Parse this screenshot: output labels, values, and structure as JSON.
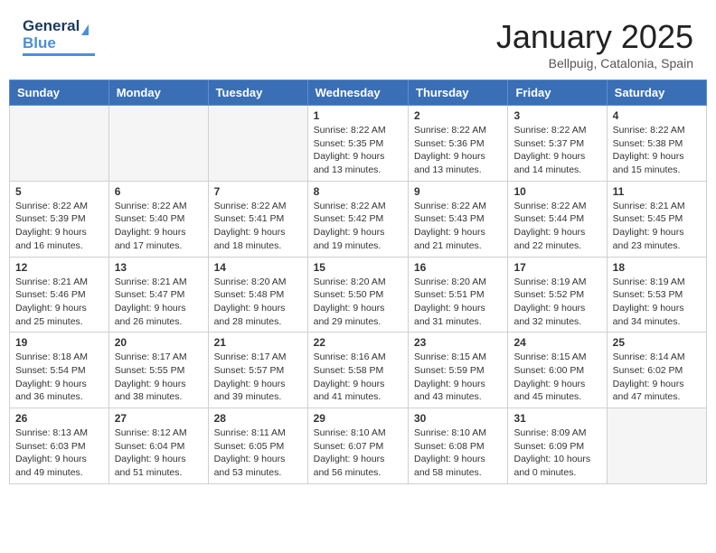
{
  "header": {
    "logo_general": "General",
    "logo_blue": "Blue",
    "month": "January 2025",
    "location": "Bellpuig, Catalonia, Spain"
  },
  "weekdays": [
    "Sunday",
    "Monday",
    "Tuesday",
    "Wednesday",
    "Thursday",
    "Friday",
    "Saturday"
  ],
  "weeks": [
    [
      {
        "day": "",
        "empty": true
      },
      {
        "day": "",
        "empty": true
      },
      {
        "day": "",
        "empty": true
      },
      {
        "day": "1",
        "sunrise": "8:22 AM",
        "sunset": "5:35 PM",
        "daylight": "9 hours and 13 minutes."
      },
      {
        "day": "2",
        "sunrise": "8:22 AM",
        "sunset": "5:36 PM",
        "daylight": "9 hours and 13 minutes."
      },
      {
        "day": "3",
        "sunrise": "8:22 AM",
        "sunset": "5:37 PM",
        "daylight": "9 hours and 14 minutes."
      },
      {
        "day": "4",
        "sunrise": "8:22 AM",
        "sunset": "5:38 PM",
        "daylight": "9 hours and 15 minutes."
      }
    ],
    [
      {
        "day": "5",
        "sunrise": "8:22 AM",
        "sunset": "5:39 PM",
        "daylight": "9 hours and 16 minutes."
      },
      {
        "day": "6",
        "sunrise": "8:22 AM",
        "sunset": "5:40 PM",
        "daylight": "9 hours and 17 minutes."
      },
      {
        "day": "7",
        "sunrise": "8:22 AM",
        "sunset": "5:41 PM",
        "daylight": "9 hours and 18 minutes."
      },
      {
        "day": "8",
        "sunrise": "8:22 AM",
        "sunset": "5:42 PM",
        "daylight": "9 hours and 19 minutes."
      },
      {
        "day": "9",
        "sunrise": "8:22 AM",
        "sunset": "5:43 PM",
        "daylight": "9 hours and 21 minutes."
      },
      {
        "day": "10",
        "sunrise": "8:22 AM",
        "sunset": "5:44 PM",
        "daylight": "9 hours and 22 minutes."
      },
      {
        "day": "11",
        "sunrise": "8:21 AM",
        "sunset": "5:45 PM",
        "daylight": "9 hours and 23 minutes."
      }
    ],
    [
      {
        "day": "12",
        "sunrise": "8:21 AM",
        "sunset": "5:46 PM",
        "daylight": "9 hours and 25 minutes."
      },
      {
        "day": "13",
        "sunrise": "8:21 AM",
        "sunset": "5:47 PM",
        "daylight": "9 hours and 26 minutes."
      },
      {
        "day": "14",
        "sunrise": "8:20 AM",
        "sunset": "5:48 PM",
        "daylight": "9 hours and 28 minutes."
      },
      {
        "day": "15",
        "sunrise": "8:20 AM",
        "sunset": "5:50 PM",
        "daylight": "9 hours and 29 minutes."
      },
      {
        "day": "16",
        "sunrise": "8:20 AM",
        "sunset": "5:51 PM",
        "daylight": "9 hours and 31 minutes."
      },
      {
        "day": "17",
        "sunrise": "8:19 AM",
        "sunset": "5:52 PM",
        "daylight": "9 hours and 32 minutes."
      },
      {
        "day": "18",
        "sunrise": "8:19 AM",
        "sunset": "5:53 PM",
        "daylight": "9 hours and 34 minutes."
      }
    ],
    [
      {
        "day": "19",
        "sunrise": "8:18 AM",
        "sunset": "5:54 PM",
        "daylight": "9 hours and 36 minutes."
      },
      {
        "day": "20",
        "sunrise": "8:17 AM",
        "sunset": "5:55 PM",
        "daylight": "9 hours and 38 minutes."
      },
      {
        "day": "21",
        "sunrise": "8:17 AM",
        "sunset": "5:57 PM",
        "daylight": "9 hours and 39 minutes."
      },
      {
        "day": "22",
        "sunrise": "8:16 AM",
        "sunset": "5:58 PM",
        "daylight": "9 hours and 41 minutes."
      },
      {
        "day": "23",
        "sunrise": "8:15 AM",
        "sunset": "5:59 PM",
        "daylight": "9 hours and 43 minutes."
      },
      {
        "day": "24",
        "sunrise": "8:15 AM",
        "sunset": "6:00 PM",
        "daylight": "9 hours and 45 minutes."
      },
      {
        "day": "25",
        "sunrise": "8:14 AM",
        "sunset": "6:02 PM",
        "daylight": "9 hours and 47 minutes."
      }
    ],
    [
      {
        "day": "26",
        "sunrise": "8:13 AM",
        "sunset": "6:03 PM",
        "daylight": "9 hours and 49 minutes."
      },
      {
        "day": "27",
        "sunrise": "8:12 AM",
        "sunset": "6:04 PM",
        "daylight": "9 hours and 51 minutes."
      },
      {
        "day": "28",
        "sunrise": "8:11 AM",
        "sunset": "6:05 PM",
        "daylight": "9 hours and 53 minutes."
      },
      {
        "day": "29",
        "sunrise": "8:10 AM",
        "sunset": "6:07 PM",
        "daylight": "9 hours and 56 minutes."
      },
      {
        "day": "30",
        "sunrise": "8:10 AM",
        "sunset": "6:08 PM",
        "daylight": "9 hours and 58 minutes."
      },
      {
        "day": "31",
        "sunrise": "8:09 AM",
        "sunset": "6:09 PM",
        "daylight": "10 hours and 0 minutes."
      },
      {
        "day": "",
        "empty": true
      }
    ]
  ]
}
